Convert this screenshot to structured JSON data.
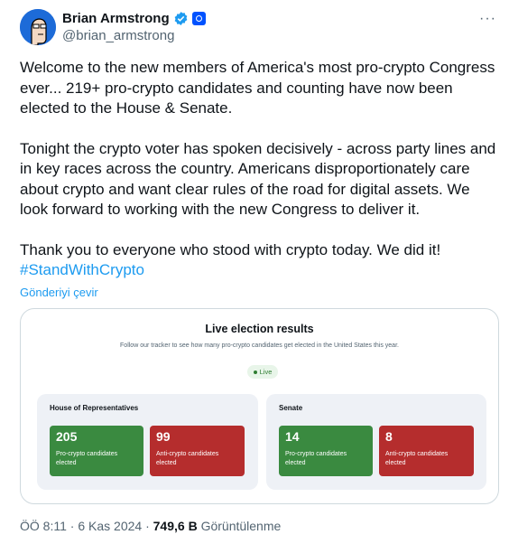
{
  "author": {
    "name": "Brian Armstrong",
    "handle": "@brian_armstrong",
    "more_label": "···"
  },
  "tweet": {
    "paragraph1": "Welcome to the new members of America's most pro-crypto Congress ever... 219+ pro-crypto candidates and counting have now been elected to the House & Senate.",
    "paragraph2": "Tonight the crypto voter has spoken decisively - across party lines and in key races across the country. Americans disproportionately care about crypto and want clear rules of the road for digital assets. We look forward to working with the new Congress to deliver it.",
    "paragraph3": "Thank you to everyone who stood with crypto today. We did it!",
    "hashtag": "#StandWithCrypto",
    "translate_label": "Gönderiyi çevir"
  },
  "card": {
    "title": "Live election results",
    "subtitle": "Follow our tracker to see how many pro-crypto candidates get elected in the United States this year.",
    "live_label": "Live",
    "house": {
      "title": "House of Representatives",
      "pro_value": "205",
      "pro_label": "Pro-crypto candidates elected",
      "anti_value": "99",
      "anti_label": "Anti-crypto candidates elected"
    },
    "senate": {
      "title": "Senate",
      "pro_value": "14",
      "pro_label": "Pro-crypto candidates elected",
      "anti_value": "8",
      "anti_label": "Anti-crypto candidates elected"
    }
  },
  "meta": {
    "time": "ÖÖ 8:11",
    "separator1": " · ",
    "date": "6 Kas 2024",
    "separator2": " · ",
    "views": "749,6 B",
    "views_label": " Görüntülenme"
  },
  "colors": {
    "link": "#1d9bf0",
    "pro": "#3a8a40",
    "anti": "#b52d2d",
    "brand": "#0052ff"
  }
}
